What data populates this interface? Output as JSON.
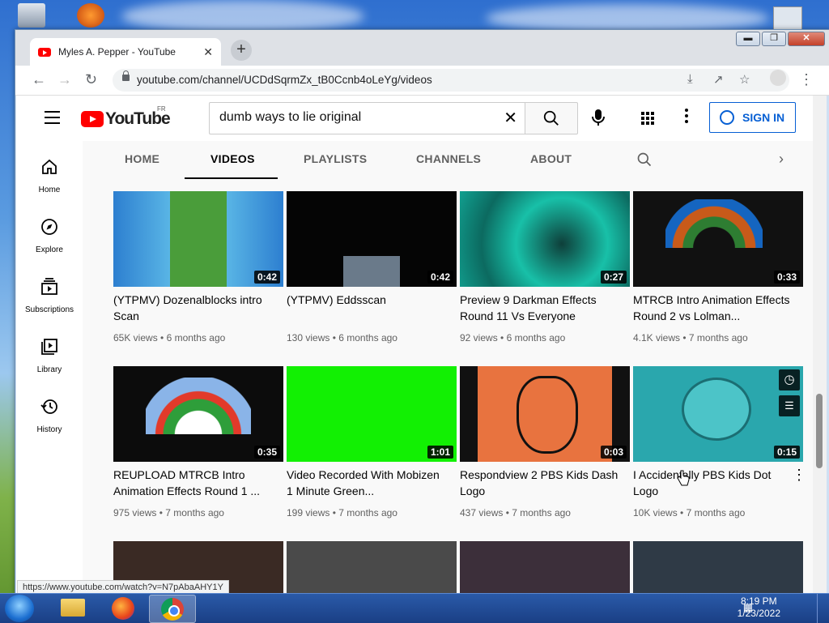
{
  "browser": {
    "tab_title": "Myles A. Pepper - YouTube",
    "tab_close": "✕",
    "new_tab": "+",
    "url": "youtube.com/channel/UCDdSqrmZx_tB0Ccnb4oLeYg/videos"
  },
  "window": {
    "minimize": "▬",
    "maximize": "❐",
    "close": "✕"
  },
  "youtube": {
    "logo_text": "YouTube",
    "country": "FR",
    "search_value": "dumb ways to lie original",
    "search_clear": "✕",
    "sign_in": "SIGN IN"
  },
  "sidebar": {
    "items": [
      {
        "label": "Home",
        "icon": "home-icon"
      },
      {
        "label": "Explore",
        "icon": "compass-icon"
      },
      {
        "label": "Subscriptions",
        "icon": "subscriptions-icon"
      },
      {
        "label": "Library",
        "icon": "library-icon"
      },
      {
        "label": "History",
        "icon": "history-icon"
      }
    ]
  },
  "channel_tabs": [
    "HOME",
    "VIDEOS",
    "PLAYLISTS",
    "CHANNELS",
    "ABOUT"
  ],
  "videos": [
    {
      "title": "(YTPMV) Dozenalblocks intro Scan",
      "views": "65K views",
      "age": "6 months ago",
      "duration": "0:42",
      "color": "#3d8fd6"
    },
    {
      "title": "(YTPMV) Eddsscan",
      "views": "130 views",
      "age": "6 months ago",
      "duration": "0:42",
      "color": "#050505"
    },
    {
      "title": "Preview 9 Darkman Effects Round 11 Vs Everyone",
      "views": "92 views",
      "age": "6 months ago",
      "duration": "0:27",
      "color": "#1aa88f"
    },
    {
      "title": "MTRCB Intro Animation Effects Round 2 vs Lolman...",
      "views": "4.1K views",
      "age": "7 months ago",
      "duration": "0:33",
      "color": "#111111"
    },
    {
      "title": "REUPLOAD MTRCB Intro Animation Effects Round 1 ...",
      "views": "975 views",
      "age": "7 months ago",
      "duration": "0:35",
      "color": "#0c0c0c"
    },
    {
      "title": "Video Recorded With Mobizen 1 Minute Green...",
      "views": "199 views",
      "age": "7 months ago",
      "duration": "1:01",
      "color": "#12f003"
    },
    {
      "title": "Respondview 2 PBS Kids Dash Logo",
      "views": "437 views",
      "age": "7 months ago",
      "duration": "0:03",
      "color": "#e8733f"
    },
    {
      "title": "I Accidentally PBS Kids Dot Logo",
      "views": "10K views",
      "age": "7 months ago",
      "duration": "0:15",
      "color": "#2aa7ad"
    }
  ],
  "row3_colors": [
    "#3a2a24",
    "#4a4a4a",
    "#3c2f3a",
    "#2f3a46"
  ],
  "status_url": "https://www.youtube.com/watch?v=N7pAbaAHY1Y",
  "taskbar": {
    "time": "8:19 PM",
    "date": "1/23/2022"
  }
}
